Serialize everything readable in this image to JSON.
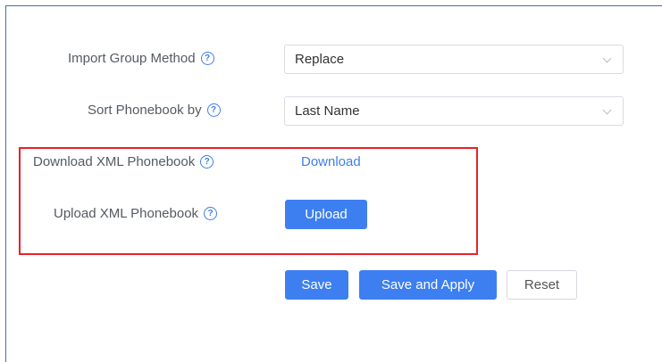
{
  "form": {
    "import_group_method": {
      "label": "Import Group Method",
      "value": "Replace"
    },
    "sort_phonebook_by": {
      "label": "Sort Phonebook by",
      "value": "Last Name"
    },
    "download_xml": {
      "label": "Download XML Phonebook",
      "action": "Download"
    },
    "upload_xml": {
      "label": "Upload XML Phonebook",
      "action": "Upload"
    }
  },
  "actions": {
    "save": "Save",
    "save_and_apply": "Save and Apply",
    "reset": "Reset"
  },
  "icons": {
    "help": "question-circle-icon",
    "dropdown": "chevron-down-icon"
  },
  "colors": {
    "primary": "#3d7ff0",
    "help_icon": "#3f7fe6",
    "highlight_border": "#e8212b",
    "frame_border": "#3d6fb6"
  },
  "help_glyph": "?"
}
